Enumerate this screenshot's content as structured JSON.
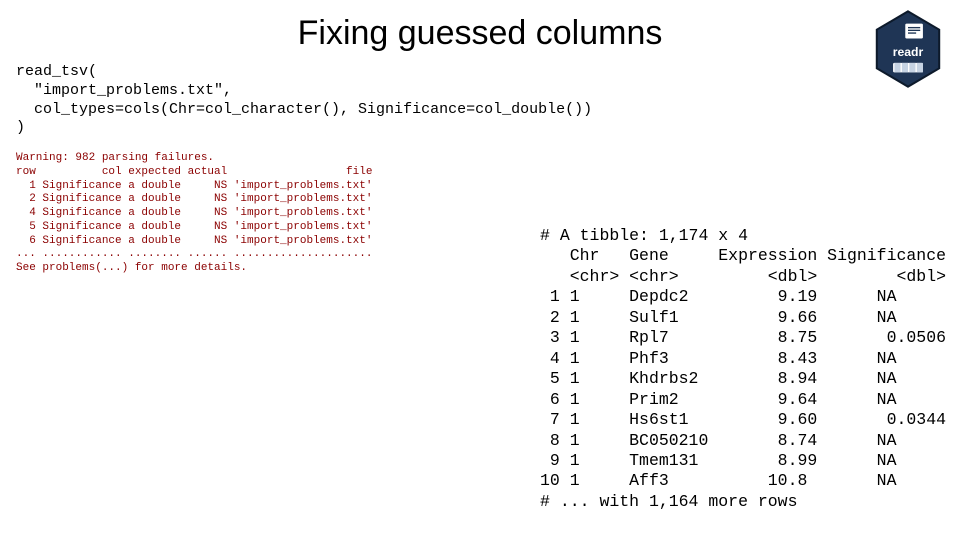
{
  "title": "Fixing guessed columns",
  "logo": {
    "label": "readr"
  },
  "code": {
    "l1": "read_tsv(",
    "l2": "  \"import_problems.txt\",",
    "l3": "  col_types=cols(Chr=col_character(), Significance=col_double())",
    "l4": ")"
  },
  "warning": {
    "l1": "Warning: 982 parsing failures.",
    "l2": "row          col expected actual                  file",
    "l3": "  1 Significance a double     NS 'import_problems.txt'",
    "l4": "  2 Significance a double     NS 'import_problems.txt'",
    "l5": "  4 Significance a double     NS 'import_problems.txt'",
    "l6": "  5 Significance a double     NS 'import_problems.txt'",
    "l7": "  6 Significance a double     NS 'import_problems.txt'",
    "l8": "... ............ ........ ...... .....................",
    "l9": "See problems(...) for more details."
  },
  "chart_data": {
    "type": "table",
    "header": "# A tibble: 1,174 x 4",
    "columns": [
      "Chr",
      "Gene",
      "Expression",
      "Significance"
    ],
    "coltypes": [
      "<chr>",
      "<chr>",
      "<dbl>",
      "<dbl>"
    ],
    "rows": [
      {
        "idx": "1",
        "Chr": "1",
        "Gene": "Depdc2",
        "Expression": "9.19",
        "Significance": "NA"
      },
      {
        "idx": "2",
        "Chr": "1",
        "Gene": "Sulf1",
        "Expression": "9.66",
        "Significance": "NA"
      },
      {
        "idx": "3",
        "Chr": "1",
        "Gene": "Rpl7",
        "Expression": "8.75",
        "Significance": "0.0506"
      },
      {
        "idx": "4",
        "Chr": "1",
        "Gene": "Phf3",
        "Expression": "8.43",
        "Significance": "NA"
      },
      {
        "idx": "5",
        "Chr": "1",
        "Gene": "Khdrbs2",
        "Expression": "8.94",
        "Significance": "NA"
      },
      {
        "idx": "6",
        "Chr": "1",
        "Gene": "Prim2",
        "Expression": "9.64",
        "Significance": "NA"
      },
      {
        "idx": "7",
        "Chr": "1",
        "Gene": "Hs6st1",
        "Expression": "9.60",
        "Significance": "0.0344"
      },
      {
        "idx": "8",
        "Chr": "1",
        "Gene": "BC050210",
        "Expression": "8.74",
        "Significance": "NA"
      },
      {
        "idx": "9",
        "Chr": "1",
        "Gene": "Tmem131",
        "Expression": "8.99",
        "Significance": "NA"
      },
      {
        "idx": "10",
        "Chr": "1",
        "Gene": "Aff3",
        "Expression": "10.8",
        "Significance": "NA"
      }
    ],
    "footer": "# ... with 1,164 more rows"
  },
  "tibble_text": {
    "l0": "# A tibble: 1,174 x 4",
    "l1": "   Chr   Gene     Expression Significance",
    "l2": "   <chr> <chr>         <dbl>        <dbl>",
    "l3": " 1 1     Depdc2         9.19      NA",
    "l4": " 2 1     Sulf1          9.66      NA",
    "l5": " 3 1     Rpl7           8.75       0.0506",
    "l6": " 4 1     Phf3           8.43      NA",
    "l7": " 5 1     Khdrbs2        8.94      NA",
    "l8": " 6 1     Prim2          9.64      NA",
    "l9": " 7 1     Hs6st1         9.60       0.0344",
    "l10": " 8 1     BC050210       8.74      NA",
    "l11": " 9 1     Tmem131        8.99      NA",
    "l12": "10 1     Aff3          10.8       NA",
    "l13": "# ... with 1,164 more rows"
  }
}
